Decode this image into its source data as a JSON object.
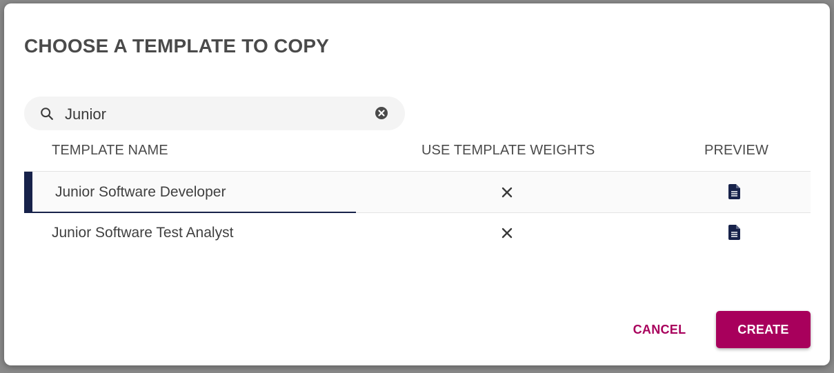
{
  "dialog": {
    "title": "CHOOSE A TEMPLATE TO COPY"
  },
  "search": {
    "value": "Junior",
    "icon": "search-icon",
    "clear_icon": "clear-icon"
  },
  "table": {
    "columns": [
      "TEMPLATE NAME",
      "USE TEMPLATE WEIGHTS",
      "PREVIEW"
    ],
    "rows": [
      {
        "name": "Junior Software Developer",
        "use_template_weights": "✕",
        "preview_icon": "document-icon",
        "selected": true
      },
      {
        "name": "Junior Software Test Analyst",
        "use_template_weights": "✕",
        "preview_icon": "document-icon",
        "selected": false
      }
    ]
  },
  "actions": {
    "cancel_label": "CANCEL",
    "create_label": "CREATE"
  },
  "colors": {
    "accent": "#a8005c",
    "selected_bar": "#17224a",
    "title": "#4a4a4a"
  }
}
